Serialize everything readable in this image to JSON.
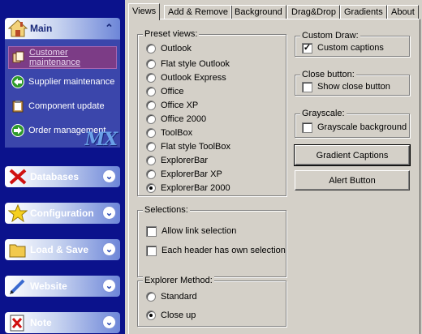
{
  "sidebar": {
    "main_panel": {
      "title": "Main",
      "icon": "house-icon",
      "toggle": "collapse-chevron",
      "items": [
        {
          "label": "Customer maintenance",
          "icon": "document-copy-icon",
          "selected": true
        },
        {
          "label": "Supplier maintenance",
          "icon": "green-arrow-left-icon"
        },
        {
          "label": "Component update",
          "icon": "clipboard-icon"
        },
        {
          "label": "Order management",
          "icon": "green-arrow-right-icon"
        }
      ],
      "logo_text": "MX"
    },
    "panels": [
      {
        "title": "Databases",
        "icon": "red-x-icon"
      },
      {
        "title": "Configuration",
        "icon": "star-icon"
      },
      {
        "title": "Load & Save",
        "icon": "folder-icon"
      },
      {
        "title": "Website",
        "icon": "pen-icon"
      },
      {
        "title": "Note",
        "icon": "note-x-icon"
      }
    ]
  },
  "tabs": [
    "Views",
    "Add & Remove",
    "Background",
    "Drag&Drop",
    "Gradients",
    "About"
  ],
  "active_tab": "Views",
  "preset_views": {
    "title": "Preset views:",
    "options": [
      "Outlook",
      "Flat style Outlook",
      "Outlook Express",
      "Office",
      "Office XP",
      "Office 2000",
      "ToolBox",
      "Flat style ToolBox",
      "ExplorerBar",
      "ExplorerBar XP",
      "ExplorerBar 2000"
    ],
    "selected": "ExplorerBar 2000"
  },
  "selections": {
    "title": "Selections:",
    "options": [
      {
        "label": "Allow link selection",
        "checked": false
      },
      {
        "label": "Each header has own selection",
        "checked": false
      }
    ]
  },
  "explorer_method": {
    "title": "Explorer Method:",
    "options": [
      "Standard",
      "Close up"
    ],
    "selected": "Close up"
  },
  "custom_draw": {
    "title": "Custom Draw:",
    "label": "Custom captions",
    "checked": true
  },
  "close_button": {
    "title": "Close button:",
    "label": "Show close button",
    "checked": false
  },
  "grayscale": {
    "title": "Grayscale:",
    "label": "Grayscale background",
    "checked": false
  },
  "buttons": {
    "gradient": "Gradient Captions",
    "alert": "Alert Button"
  },
  "colors": {
    "sidebar_bg": "#0b128c",
    "selected_item": "#7c3c86",
    "window_bg": "#d4d0c8"
  }
}
